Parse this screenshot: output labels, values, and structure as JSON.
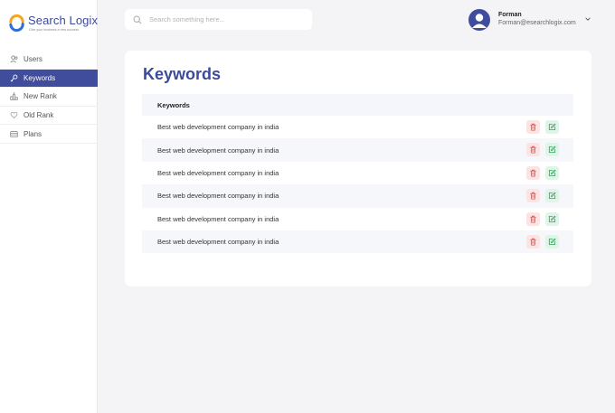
{
  "brand": {
    "name": "Search Logix",
    "tagline": "Give your business a new success",
    "colors": {
      "primary": "#3f4d9c",
      "logo_orange": "#f5a623",
      "logo_blue": "#2e6fd8"
    }
  },
  "sidebar": {
    "items": [
      {
        "label": "Users",
        "icon": "users-icon",
        "active": false
      },
      {
        "label": "Keywords",
        "icon": "key-icon",
        "active": true
      },
      {
        "label": "New Rank",
        "icon": "rank-icon",
        "active": false
      },
      {
        "label": "Old Rank",
        "icon": "heart-icon",
        "active": false
      },
      {
        "label": "Plans",
        "icon": "card-icon",
        "active": false
      }
    ]
  },
  "search": {
    "placeholder": "Search something here..."
  },
  "user": {
    "name": "Forman",
    "email": "Forman@esearchlogix.com"
  },
  "main": {
    "title": "Keywords",
    "table": {
      "header": "Keywords",
      "rows": [
        "Best web development company in india",
        "Best web development company in india",
        "Best web development company in india",
        "Best web development company in india",
        "Best web development company in india",
        "Best web development company in india"
      ],
      "colors": {
        "delete": "#e05252",
        "edit": "#2fa85b"
      }
    }
  }
}
